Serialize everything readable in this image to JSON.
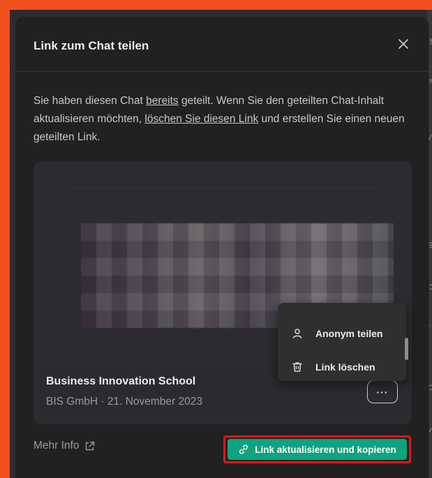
{
  "dialog": {
    "title": "Link zum Chat teilen",
    "description": {
      "part1": "Sie haben diesen Chat ",
      "link1": "bereits",
      "part2": " geteilt. Wenn Sie den geteilten Chat-Inhalt aktualisieren möchten, ",
      "link2": "löschen Sie diesen Link",
      "part3": " und erstellen Sie einen neuen geteilten Link."
    }
  },
  "card": {
    "name": "Business Innovation School",
    "meta": "BIS GmbH · 21. November 2023",
    "more_label": "···"
  },
  "menu": {
    "items": [
      {
        "label": "Anonym teilen",
        "icon": "user-icon"
      },
      {
        "label": "Link löschen",
        "icon": "trash-icon"
      }
    ]
  },
  "footer": {
    "more_info": "Mehr Info",
    "cta": "Link aktualisieren und kopieren"
  },
  "background_glyphs": [
    "B",
    "e",
    "y",
    "S",
    "D",
    "f",
    "C",
    "v"
  ],
  "colors": {
    "accent": "#10a37f",
    "highlight": "#e5131b",
    "annotation": "#f0511e"
  }
}
